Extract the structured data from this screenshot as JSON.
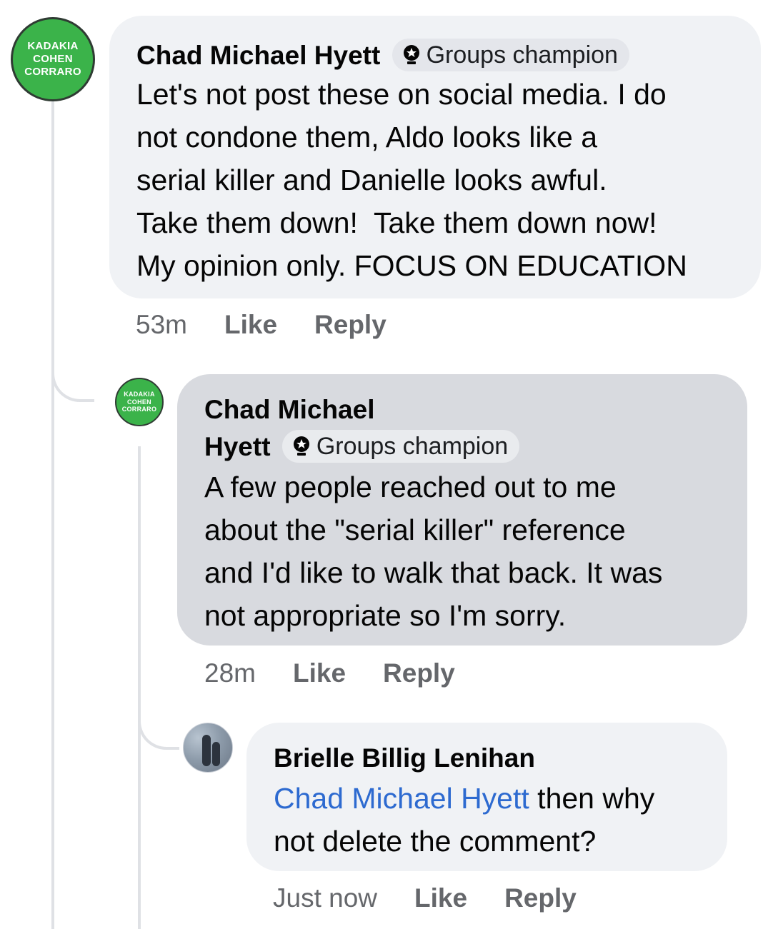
{
  "comments": [
    {
      "avatar": {
        "brand_lines": [
          "KADAKIA",
          "COHEN",
          "CORRARO"
        ]
      },
      "author": "Chad Michael Hyett",
      "badge": "Groups champion",
      "text_lines": [
        "Let's not post these on social media. I do",
        "not condone them, Aldo looks like a",
        "serial killer and Danielle looks awful.",
        "Take them down!  Take them down now!",
        "My opinion only. FOCUS ON EDUCATION"
      ],
      "time": "53m",
      "like_label": "Like",
      "reply_label": "Reply"
    },
    {
      "avatar": {
        "brand_lines": [
          "KADAKIA",
          "COHEN",
          "CORRARO"
        ]
      },
      "author_line1": "Chad Michael",
      "author_line2": "Hyett",
      "badge": "Groups champion",
      "text_lines": [
        "A few people reached out to me",
        "about the \"serial killer\" reference",
        "and I'd like to walk that back. It was",
        "not appropriate so I'm sorry."
      ],
      "time": "28m",
      "like_label": "Like",
      "reply_label": "Reply"
    },
    {
      "author": "Brielle Billig Lenihan",
      "mention": "Chad Michael Hyett",
      "text_line1_rest": " then why",
      "text_line2": "not delete the comment?",
      "time": "Just now",
      "like_label": "Like",
      "reply_label": "Reply"
    }
  ],
  "colors": {
    "bubble": "#f0f2f5",
    "bubble_highlighted": "#d8dadf",
    "mention": "#2d6ad0",
    "meta": "#65676b",
    "brand_green": "#3bb34a"
  },
  "icons": {
    "badge": "groups-champion-icon"
  }
}
